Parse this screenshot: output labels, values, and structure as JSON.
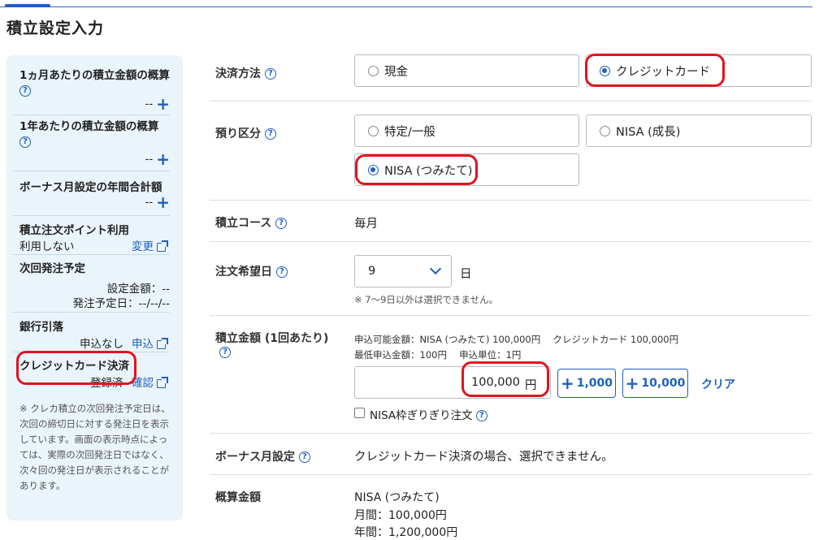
{
  "page_title": "積立設定入力",
  "colors": {
    "accent": "#1f5fbf",
    "highlight": "#e0141e",
    "sidebar_bg": "#eaf4fb"
  },
  "sidebar": {
    "monthly_label": "1ヵ月あたりの積立金額の概算",
    "monthly_value": "--",
    "yearly_label": "1年あたりの積立金額の概算",
    "yearly_value": "--",
    "bonus_label": "ボーナス月設定の年間合計額",
    "bonus_value": "--",
    "points_label": "積立注文ポイント利用",
    "points_value": "利用しない",
    "points_link": "変更",
    "next_order_label": "次回発注予定",
    "next_amount": "設定金額：--",
    "next_date": "発注予定日：--/--/--",
    "bank_label": "銀行引落",
    "bank_value": "申込なし",
    "bank_link": "申込",
    "card_label": "クレジットカード決済",
    "card_value": "登録済",
    "card_link": "確認",
    "note": "※ クレカ積立の次回発注予定日は、次回の締切日に対する発注日を表示しています。画面の表示時点によっては、実際の次回発注日ではなく、次々回の発注日が表示されることがあります。"
  },
  "payment": {
    "label": "決済方法",
    "options": [
      "現金",
      "クレジットカード"
    ],
    "selected": "クレジットカード"
  },
  "account": {
    "label": "預り区分",
    "options": [
      "特定/一般",
      "NISA (成長)",
      "NISA (つみたて)"
    ],
    "selected": "NISA (つみたて)"
  },
  "course": {
    "label": "積立コース",
    "value": "毎月"
  },
  "order_day": {
    "label": "注文希望日",
    "value": "9",
    "unit": "日",
    "note": "※ 7〜9日以外は選択できません。"
  },
  "amount": {
    "label": "積立金額 (1回あたり)",
    "limits_line1": "申込可能金額：NISA (つみたて) 100,000円　 クレジットカード 100,000円",
    "limits_line2": "最低申込金額：100円　 申込単位：1円",
    "value": "100,000",
    "unit": "円",
    "add_small": "1,000",
    "add_large": "10,000",
    "clear": "クリア",
    "nisa_limit_checkbox": "NISA枠ぎりぎり注文"
  },
  "bonus": {
    "label": "ボーナス月設定",
    "value": "クレジットカード決済の場合、選択できません。"
  },
  "estimate": {
    "label": "概算金額",
    "account": "NISA (つみたて)",
    "monthly": "月間：100,000円",
    "yearly": "年間：1,200,000円"
  }
}
